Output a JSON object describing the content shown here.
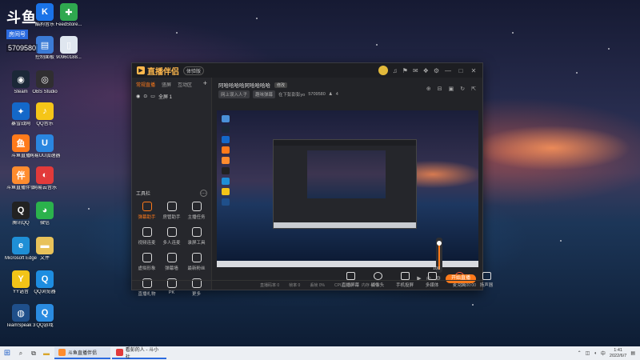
{
  "desktop": {
    "channel_overlay": {
      "logo": "斗鱼",
      "tag": "房间号",
      "room": "5709580"
    },
    "icons": [
      {
        "id": "recycle",
        "label": "此电脑",
        "color": "#4a90d9",
        "glyph": "▣"
      },
      {
        "id": "kugou",
        "label": "酷狗音乐",
        "color": "#1a73e8",
        "glyph": "K"
      },
      {
        "id": "feedstore",
        "label": "FeedStore...",
        "color": "#2fa84f",
        "glyph": "✚"
      },
      {
        "id": "pc",
        "label": "回收站",
        "color": "#6fa3d9",
        "glyph": "🗑"
      },
      {
        "id": "ctrl",
        "label": "控制面板",
        "color": "#3b7bd6",
        "glyph": "▤"
      },
      {
        "id": "file",
        "label": "90960188...",
        "color": "#dfe6ef",
        "glyph": "▯"
      },
      {
        "id": "steam",
        "label": "Steam",
        "color": "#1b2838",
        "glyph": "◉"
      },
      {
        "id": "obs",
        "label": "OBS Studio",
        "color": "#302e31",
        "glyph": "◎"
      },
      {
        "id": "nvidia",
        "label": "暴雪战网",
        "color": "#1468c9",
        "glyph": "✦"
      },
      {
        "id": "qqmusic",
        "label": "QQ音乐",
        "color": "#f5c518",
        "glyph": "♪"
      },
      {
        "id": "douyu1",
        "label": "斗鱼直播",
        "color": "#ff7a1a",
        "glyph": "鱼"
      },
      {
        "id": "uu",
        "label": "网易UU加速器",
        "color": "#2a86e0",
        "glyph": "U"
      },
      {
        "id": "douyu2",
        "label": "斗鱼直播伴侣",
        "color": "#ff8c2e",
        "glyph": "伴"
      },
      {
        "id": "netease",
        "label": "网易云音乐",
        "color": "#e23a3a",
        "glyph": "◐"
      },
      {
        "id": "qq",
        "label": "腾讯QQ",
        "color": "#222",
        "glyph": "Q"
      },
      {
        "id": "wechat",
        "label": "微信",
        "color": "#2bb24c",
        "glyph": "◕"
      },
      {
        "id": "edge",
        "label": "Microsoft Edge",
        "color": "#1f8fd6",
        "glyph": "e"
      },
      {
        "id": "folder",
        "label": "文件",
        "color": "#e8c25a",
        "glyph": "▬"
      },
      {
        "id": "yy",
        "label": "YY语音",
        "color": "#f2c418",
        "glyph": "Y"
      },
      {
        "id": "qqbrowser",
        "label": "QQ浏览器",
        "color": "#1e8de0",
        "glyph": "Q"
      },
      {
        "id": "teamspeak",
        "label": "TeamSpeak 3",
        "color": "#1f4f8a",
        "glyph": "◍"
      },
      {
        "id": "qqgame",
        "label": "QQ游戏",
        "color": "#2a8be0",
        "glyph": "Q"
      }
    ]
  },
  "app": {
    "logo": "直播伴侣",
    "badge": "体验版",
    "window_controls": [
      "—",
      "□",
      "✕"
    ],
    "scene_tabs": [
      {
        "label": "常规直播",
        "active": true
      },
      {
        "label": "竖屏",
        "active": false
      },
      {
        "label": "互动区",
        "active": false
      }
    ],
    "scene_item": "全屏 1",
    "tools_title": "工具栏",
    "tools": [
      {
        "label": "弹幕助手",
        "hot": true
      },
      {
        "label": "房管助手",
        "hot": false
      },
      {
        "label": "主播任务",
        "hot": false
      },
      {
        "label": "视频连麦",
        "hot": false
      },
      {
        "label": "多人连麦",
        "hot": false
      },
      {
        "label": "录屏工具",
        "hot": false
      },
      {
        "label": "虚拟形象",
        "hot": false
      },
      {
        "label": "弹幕墙",
        "hot": false
      },
      {
        "label": "最新粉丝",
        "hot": false
      },
      {
        "label": "直播礼物",
        "hot": false
      },
      {
        "label": "PK",
        "hot": false
      },
      {
        "label": "更多",
        "hot": false
      }
    ],
    "stream_title": "阿哈哈哈哈阿哈哈哈哈",
    "edit_label": "修改",
    "meta": {
      "category": "网上误入人子",
      "sub": "趣味弹幕",
      "host": "在下彭彭彭yo",
      "room": "5709580",
      "viewers": "4"
    },
    "volume_value": "100",
    "controls": [
      {
        "label": "直播屏幕",
        "kind": "rect"
      },
      {
        "label": "摄像头",
        "kind": "round"
      },
      {
        "label": "手机投屏",
        "kind": "rect"
      },
      {
        "label": "多媒体",
        "kind": "rect"
      },
      {
        "label": "麦克风",
        "kind": "mic"
      },
      {
        "label": "扬声器",
        "kind": "rect"
      }
    ],
    "go_live": "开始直播",
    "status": [
      {
        "label": "直播码率 0"
      },
      {
        "label": "帧率 0"
      },
      {
        "label": "丢帧 0%"
      },
      {
        "label": "CPU 10%"
      },
      {
        "label": "内存 45%"
      }
    ],
    "timer": "00:00:00"
  },
  "taskbar": {
    "tasks": [
      {
        "label": "斗鱼直播伴侣",
        "color": "#ff8c2e"
      },
      {
        "label": "看彭的人 - 斗小社",
        "color": "#e23a3a"
      }
    ],
    "time": "1:41",
    "date": "2022/6/7"
  }
}
